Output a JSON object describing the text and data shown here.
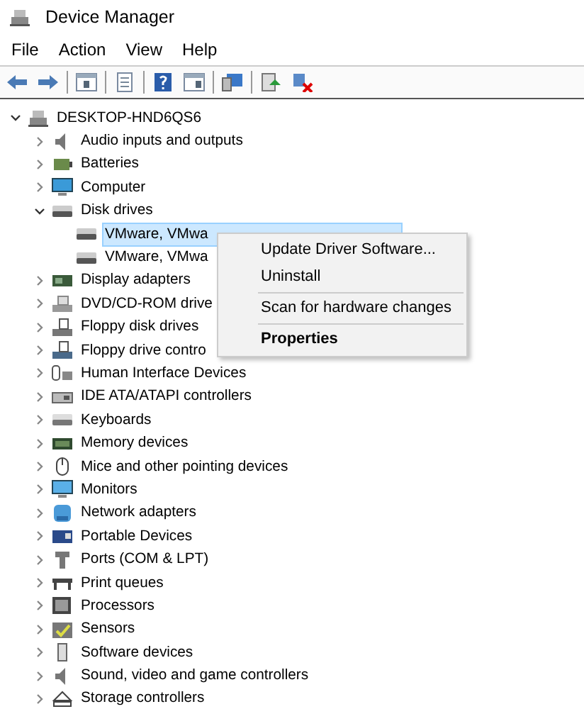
{
  "window": {
    "title": "Device Manager"
  },
  "menu": [
    "File",
    "Action",
    "View",
    "Help"
  ],
  "toolbar": [
    {
      "kind": "back"
    },
    {
      "kind": "forward"
    },
    {
      "kind": "sep"
    },
    {
      "kind": "panel"
    },
    {
      "kind": "sep"
    },
    {
      "kind": "sheet"
    },
    {
      "kind": "sep"
    },
    {
      "kind": "help"
    },
    {
      "kind": "panel2"
    },
    {
      "kind": "sep"
    },
    {
      "kind": "scan"
    },
    {
      "kind": "sep"
    },
    {
      "kind": "update"
    },
    {
      "kind": "uninstall"
    }
  ],
  "tree": {
    "label": "DESKTOP-HND6QS6",
    "expanded": true,
    "children": [
      {
        "label": "Audio inputs and outputs",
        "expanded": false
      },
      {
        "label": "Batteries",
        "expanded": false
      },
      {
        "label": "Computer",
        "expanded": false
      },
      {
        "label": "Disk drives",
        "expanded": true,
        "children": [
          {
            "label": "VMware, VMwa",
            "selected": true
          },
          {
            "label": "VMware, VMwa",
            "selected": false
          }
        ]
      },
      {
        "label": "Display adapters",
        "expanded": false
      },
      {
        "label": "DVD/CD-ROM drive",
        "expanded": false
      },
      {
        "label": "Floppy disk drives",
        "expanded": false
      },
      {
        "label": "Floppy drive contro",
        "expanded": false
      },
      {
        "label": "Human Interface Devices",
        "expanded": false
      },
      {
        "label": "IDE ATA/ATAPI controllers",
        "expanded": false
      },
      {
        "label": "Keyboards",
        "expanded": false
      },
      {
        "label": "Memory devices",
        "expanded": false
      },
      {
        "label": "Mice and other pointing devices",
        "expanded": false
      },
      {
        "label": "Monitors",
        "expanded": false
      },
      {
        "label": "Network adapters",
        "expanded": false
      },
      {
        "label": "Portable Devices",
        "expanded": false
      },
      {
        "label": "Ports (COM & LPT)",
        "expanded": false
      },
      {
        "label": "Print queues",
        "expanded": false
      },
      {
        "label": "Processors",
        "expanded": false
      },
      {
        "label": "Sensors",
        "expanded": false
      },
      {
        "label": "Software devices",
        "expanded": false
      },
      {
        "label": "Sound, video and game controllers",
        "expanded": false
      },
      {
        "label": "Storage controllers",
        "expanded": false
      }
    ]
  },
  "context_menu": [
    {
      "kind": "item",
      "label": "Update Driver Software...",
      "default": false
    },
    {
      "kind": "item",
      "label": "Uninstall",
      "default": false
    },
    {
      "kind": "separator"
    },
    {
      "kind": "item",
      "label": "Scan for hardware changes",
      "default": false
    },
    {
      "kind": "separator"
    },
    {
      "kind": "item",
      "label": "Properties",
      "default": true
    }
  ]
}
